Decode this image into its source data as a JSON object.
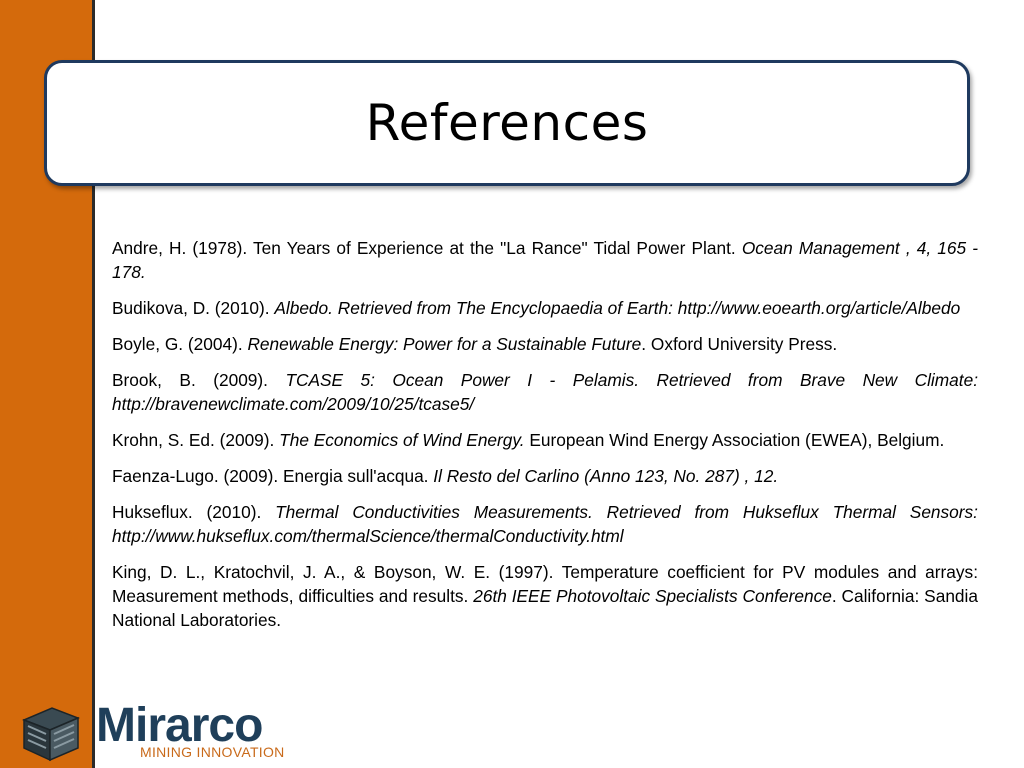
{
  "slide": {
    "title": "References",
    "references": [
      {
        "author": "Andre, H. (1978). Ten Years of Experience at the \"La Rance\" Tidal Power Plant. ",
        "source": "Ocean Management , 4, 165 - 178.",
        "tail": ""
      },
      {
        "author": "Budikova, D. (2010). ",
        "source": "Albedo. Retrieved from The Encyclopaedia of Earth: http://www.eoearth.org/article/Albedo",
        "tail": ""
      },
      {
        "author": "Boyle, G. (2004). ",
        "source": "Renewable Energy: Power for a Sustainable Future",
        "tail": ". Oxford University Press."
      },
      {
        "author": "Brook, B. (2009). ",
        "source": "TCASE 5: Ocean Power I - Pelamis. Retrieved from Brave New Climate: http://bravenewclimate.com/2009/10/25/tcase5/",
        "tail": ""
      },
      {
        "author": "Krohn, S. Ed. (2009). ",
        "source": "The Economics of Wind Energy.",
        "tail": " European Wind Energy Association (EWEA), Belgium."
      },
      {
        "author": "Faenza-Lugo. (2009). Energia sull'acqua. ",
        "source": "Il Resto del Carlino (Anno 123, No. 287) , 12.",
        "tail": ""
      },
      {
        "author": "Hukseflux. (2010). ",
        "source": "Thermal Conductivities Measurements. Retrieved from Hukseflux Thermal Sensors: http://www.hukseflux.com/thermalScience/thermalConductivity.html",
        "tail": ""
      },
      {
        "author": "King, D. L., Kratochvil, J. A., & Boyson, W. E. (1997). Temperature coefficient for PV modules and arrays: Measurement methods, difficulties and results. ",
        "source": "26th IEEE Photovoltaic Specialists Conference",
        "tail": ". California: Sandia National Laboratories."
      }
    ]
  },
  "logo": {
    "name": "Mirarco",
    "tagline": "MINING INNOVATION",
    "icon": "mining-cube-icon"
  },
  "colors": {
    "sidebar": "#d46a0c",
    "title_border": "#1f3a5f",
    "logo_blue": "#1f3f5a",
    "logo_orange": "#c96a1a"
  }
}
